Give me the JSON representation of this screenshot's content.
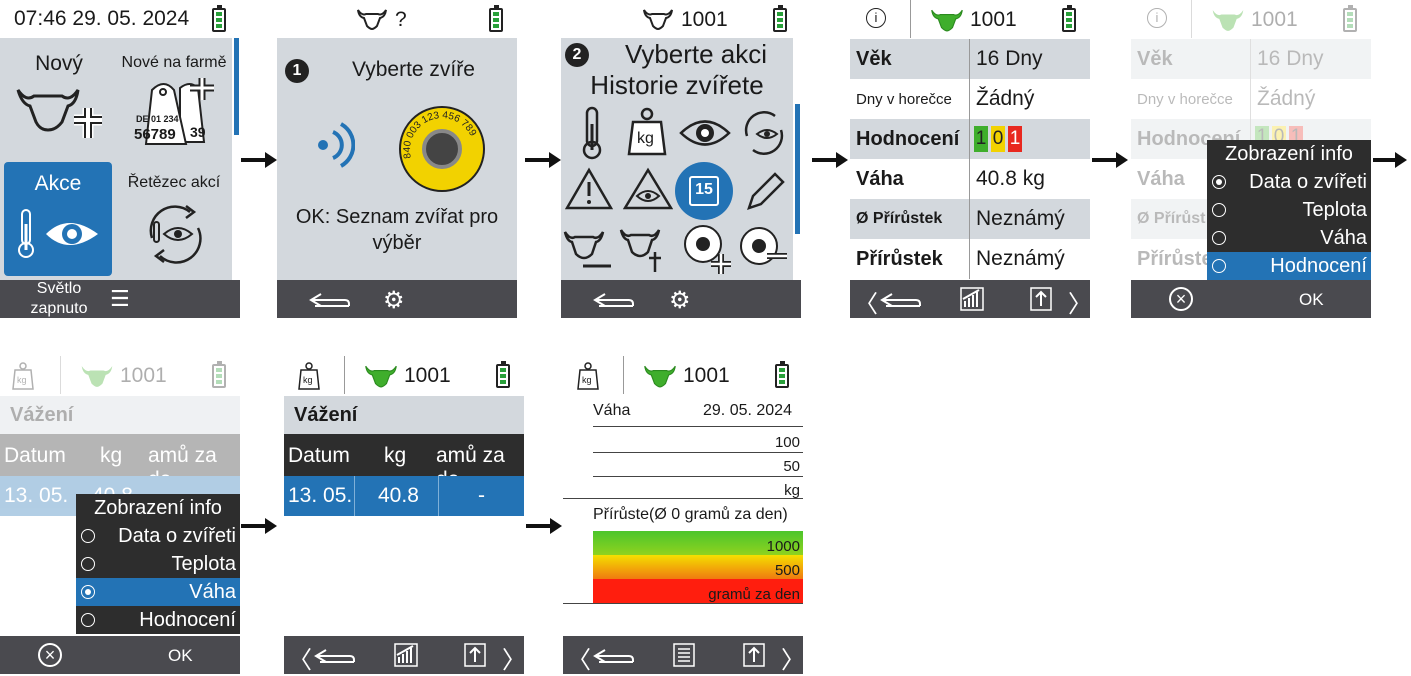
{
  "s1": {
    "time": "07:46 29. 05. 2024",
    "tile_new": "Nový",
    "tile_farm": "Nové na farmě",
    "tile_action": "Akce",
    "tile_chain": "Řetězec akcí",
    "light_label": "Světlo zapnuto",
    "tag_line1": "DE 01 234",
    "tag_line2": "56789",
    "tag_side": "39"
  },
  "s2": {
    "header": "?",
    "step": "1",
    "title": "Vyberte zvíře",
    "tag_text": "840 003 123 456 789",
    "hint": "OK: Seznam zvířat pro výběr"
  },
  "s3": {
    "header": "1001",
    "step": "2",
    "title1": "Vyberte akci",
    "title2": "Historie zvířete",
    "calendar_day": "15",
    "kg_label": "kg"
  },
  "s4": {
    "header": "1001",
    "rows": [
      {
        "k": "Věk",
        "v": "16 Dny"
      },
      {
        "k": "Dny v horečce",
        "v": "Žádný"
      },
      {
        "k": "Hodnocení",
        "v": ""
      },
      {
        "k": "Váha",
        "v": "40.8 kg"
      },
      {
        "k": "Ø Přírůstek",
        "v": "Neznámý"
      },
      {
        "k": "Přírůstek",
        "v": "Neznámý"
      }
    ],
    "scores": [
      "1",
      "0",
      "1"
    ]
  },
  "s5": {
    "header": "1001",
    "popup_title": "Zobrazení info",
    "options": [
      "Data o zvířeti",
      "Teplota",
      "Váha",
      "Hodnocení"
    ],
    "ok": "OK",
    "bg_rows": [
      {
        "k": "Věk",
        "v": "16 Dny"
      },
      {
        "k": "Dny v horečce",
        "v": "Žádný"
      },
      {
        "k": "Hodnocení",
        "v": ""
      },
      {
        "k": "Váha",
        "v": ""
      },
      {
        "k": "Ø Přírůst",
        "v": ""
      },
      {
        "k": "Přírůste",
        "v": ""
      }
    ]
  },
  "s6": {
    "header": "1001",
    "section": "Vážení",
    "cols": [
      "Datum",
      "kg",
      "amů za de"
    ],
    "row": [
      "13. 05.",
      "40.8"
    ],
    "popup_title": "Zobrazení info",
    "options": [
      "Data o zvířeti",
      "Teplota",
      "Váha",
      "Hodnocení"
    ],
    "ok": "OK",
    "kg_label": "kg"
  },
  "s7": {
    "header": "1001",
    "section": "Vážení",
    "cols": [
      "Datum",
      "kg",
      "amů za de"
    ],
    "row": [
      "13. 05.",
      "40.8",
      "-"
    ],
    "kg_label": "kg"
  },
  "s8": {
    "header": "1001",
    "weight_label": "Váha",
    "date": "29. 05. 2024",
    "w_ticks": [
      "100",
      "50",
      "kg"
    ],
    "gain_label": "Přírůste(Ø 0 gramů za den)",
    "g_ticks": [
      "1000",
      "500",
      "gramů za den"
    ],
    "kg_label": "kg"
  },
  "colors": {
    "blue": "#2373b5",
    "bar": "#4a4a4f",
    "panel": "#d3d8dd",
    "green": "#3fae2c",
    "yellow": "#f2d200",
    "red": "#e8281f"
  }
}
